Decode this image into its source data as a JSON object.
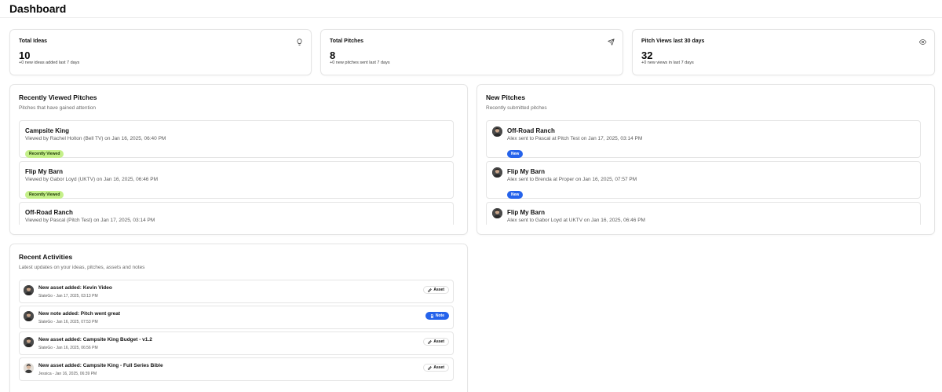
{
  "header": {
    "title": "Dashboard"
  },
  "stats": [
    {
      "title": "Total Ideas",
      "value": "10",
      "sub": "+0 new ideas added last 7 days",
      "icon": "lightbulb-icon"
    },
    {
      "title": "Total Pitches",
      "value": "8",
      "sub": "+0 new pitches sent last 7 days",
      "icon": "send-icon"
    },
    {
      "title": "Pitch Views last 30 days",
      "value": "32",
      "sub": "+0 new views in last 7 days",
      "icon": "eye-icon"
    }
  ],
  "recently_viewed": {
    "title": "Recently Viewed Pitches",
    "subtitle": "Pitches that have gained attention",
    "items": [
      {
        "title": "Campsite King",
        "desc": "Viewed by Rachel Holton (Bell TV) on Jan 16, 2025, 06:40 PM",
        "badge": "Recently Viewed"
      },
      {
        "title": "Flip My Barn",
        "desc": "Viewed by Gabor Loyd (UKTV) on Jan 16, 2025, 06:46 PM",
        "badge": "Recently Viewed"
      },
      {
        "title": "Off-Road Ranch",
        "desc": "Viewed by Pascal (Pitch Test) on Jan 17, 2025, 03:14 PM",
        "badge": ""
      }
    ]
  },
  "new_pitches": {
    "title": "New Pitches",
    "subtitle": "Recently submitted pitches",
    "items": [
      {
        "title": "Off-Road Ranch",
        "desc": "Alex sent to Pascal at Pitch Test on Jan 17, 2025, 03:14 PM",
        "badge": "New"
      },
      {
        "title": "Flip My Barn",
        "desc": "Alex sent to Brenda at Proper on Jan 16, 2025, 07:57 PM",
        "badge": "New"
      },
      {
        "title": "Flip My Barn",
        "desc": "Alex sent to Gabor Loyd at UKTV on Jan 16, 2025, 06:46 PM",
        "badge": ""
      }
    ]
  },
  "activities": {
    "title": "Recent Activities",
    "subtitle": "Latest updates on your ideas, pitches, assets and notes",
    "items": [
      {
        "title": "New asset added: Kevin Video",
        "meta": "SlateGo - Jan 17, 2025, 03:13 PM",
        "tag": "Asset",
        "tag_style": "outline",
        "tag_icon": "pencil-icon"
      },
      {
        "title": "New note added: Pitch went great",
        "meta": "SlateGo - Jan 16, 2025, 07:53 PM",
        "tag": "Note",
        "tag_style": "solid",
        "tag_icon": "document-icon"
      },
      {
        "title": "New asset added: Campsite King Budget - v1.2",
        "meta": "SlateGo - Jan 16, 2025, 06:56 PM",
        "tag": "Asset",
        "tag_style": "outline",
        "tag_icon": "pencil-icon"
      },
      {
        "title": "New asset added: Campsite King - Full Series Bible",
        "meta": "Jessica - Jan 16, 2025, 06:39 PM",
        "tag": "Asset",
        "tag_style": "outline",
        "tag_icon": "pencil-icon"
      }
    ]
  },
  "colors": {
    "badge_green": "#c5f08a",
    "badge_blue": "#2563eb",
    "border": "#e5e5e5"
  }
}
